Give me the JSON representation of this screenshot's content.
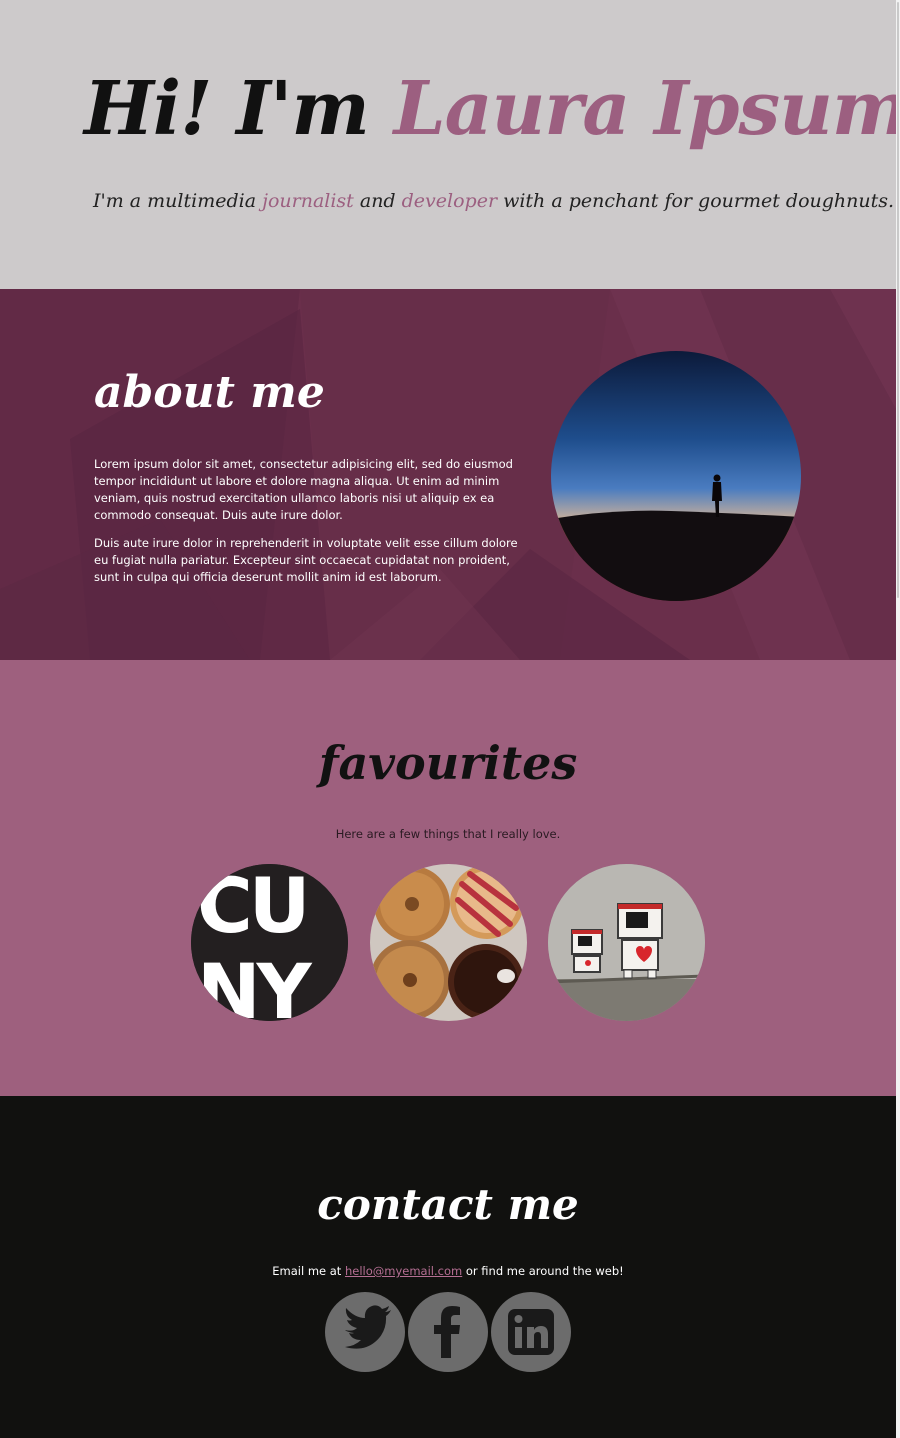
{
  "hero": {
    "greeting": "Hi! I'm ",
    "name": "Laura Ipsum",
    "name_suffix": ".",
    "tagline_1": "I'm a multimedia ",
    "tagline_journalist": "journalist",
    "tagline_2": " and ",
    "tagline_developer": "developer",
    "tagline_3": " with a penchant for gourmet doughnuts."
  },
  "about": {
    "title": "about me",
    "paragraph_1": "Lorem ipsum dolor sit amet, consectetur adipisicing elit, sed do eiusmod tempor incididunt ut labore et dolore magna aliqua. Ut enim ad minim veniam, quis nostrud exercitation ullamco laboris nisi ut aliquip ex ea commodo consequat. Duis aute irure dolor.",
    "paragraph_2": "Duis aute irure dolor in reprehenderit in voluptate velit esse cillum dolore eu fugiat nulla pariatur. Excepteur sint occaecat cupidatat non proident, sunt in culpa qui officia deserunt mollit anim id est laborum."
  },
  "favourites": {
    "title": "favourites",
    "subtitle": "Here are a few things that I really love.",
    "items": [
      {
        "name": "cuny-logo",
        "logo_text_1": "CU",
        "logo_text_2": "NY"
      },
      {
        "name": "doughnuts-photo"
      },
      {
        "name": "street-art-photo"
      }
    ]
  },
  "contact": {
    "title": "contact me",
    "email_prefix": "Email me at ",
    "email": "hello@myemail.com",
    "email_suffix": " or find me around the web!",
    "social": [
      {
        "name": "twitter",
        "icon": "twitter-icon"
      },
      {
        "name": "facebook",
        "icon": "facebook-icon"
      },
      {
        "name": "linkedin",
        "icon": "linkedin-icon"
      }
    ]
  },
  "colors": {
    "hero_bg": "#cdcacb",
    "accent": "#9c5f80",
    "about_bg": "#6a2f4b",
    "favourites_bg": "#9e607e",
    "contact_bg": "#11110f",
    "social_icon_bg": "#6c6c6c"
  }
}
